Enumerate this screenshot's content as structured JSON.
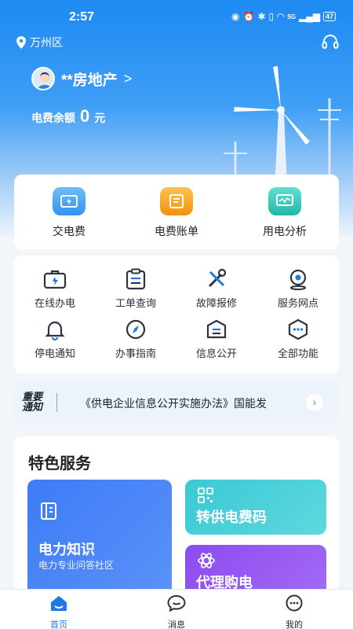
{
  "status": {
    "time": "2:57",
    "battery": "47",
    "network": "5G"
  },
  "header": {
    "location": "万州区"
  },
  "user": {
    "name": "**房地产",
    "chevron": ">"
  },
  "balance": {
    "label": "电费余额",
    "amount": "0",
    "unit": "元"
  },
  "quick": [
    {
      "label": "交电费",
      "icon": "wallet-icon",
      "color": "#3aa0f3"
    },
    {
      "label": "电费账单",
      "icon": "bill-icon",
      "color": "#f5a019"
    },
    {
      "label": "用电分析",
      "icon": "analysis-icon",
      "color": "#2ec9b8"
    }
  ],
  "grid": [
    {
      "label": "在线办电",
      "icon": "briefcase-icon"
    },
    {
      "label": "工单查询",
      "icon": "clipboard-icon"
    },
    {
      "label": "故障报修",
      "icon": "tools-icon"
    },
    {
      "label": "服务网点",
      "icon": "location-pin-icon"
    },
    {
      "label": "停电通知",
      "icon": "bell-icon"
    },
    {
      "label": "办事指南",
      "icon": "compass-icon"
    },
    {
      "label": "信息公开",
      "icon": "info-box-icon"
    },
    {
      "label": "全部功能",
      "icon": "more-icon"
    }
  ],
  "notice": {
    "tag_line1": "重要",
    "tag_line2": "通知",
    "text": "《供电企业信息公开实施办法》国能发"
  },
  "feature": {
    "title": "特色服务",
    "tiles": [
      {
        "title": "电力知识",
        "subtitle": "电力专业问答社区",
        "icon": "book-icon"
      },
      {
        "title": "转供电费码",
        "icon": "qr-code-icon"
      },
      {
        "title": "代理购电",
        "icon": "atom-icon"
      }
    ]
  },
  "tabs": [
    {
      "label": "首页",
      "icon": "home-icon",
      "active": true
    },
    {
      "label": "消息",
      "icon": "message-icon",
      "active": false
    },
    {
      "label": "我的",
      "icon": "profile-icon",
      "active": false
    }
  ],
  "colors": {
    "primary": "#1d78e8",
    "hero_top": "#1d8af2"
  }
}
